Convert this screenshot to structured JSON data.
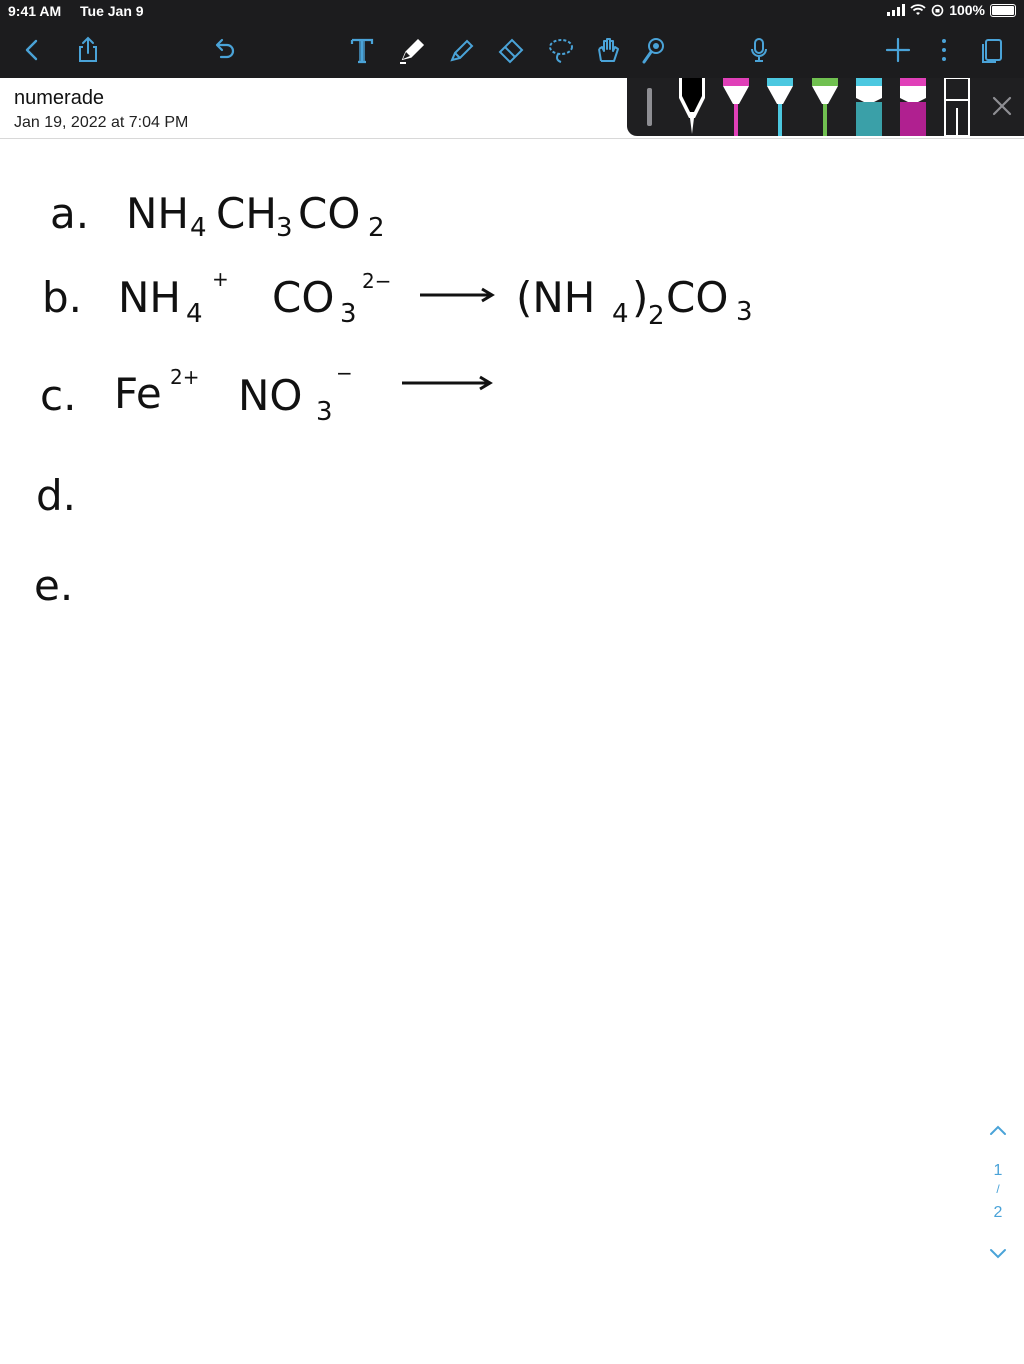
{
  "status_bar": {
    "time": "9:41 AM",
    "date": "Tue Jan 9",
    "battery": "100%"
  },
  "toolbar": {
    "icons": [
      "back-icon",
      "share-icon",
      "undo-icon",
      "text-tool-icon",
      "pen-tool-icon",
      "highlighter-tool-icon",
      "eraser-tool-icon",
      "lasso-tool-icon",
      "hand-tool-icon",
      "shapes-tool-icon",
      "microphone-icon",
      "add-icon",
      "more-icon",
      "pages-icon"
    ],
    "icon_color": "#4aa3d8"
  },
  "document": {
    "title": "numerade",
    "date": "Jan 19, 2022 at 7:04 PM"
  },
  "pen_tray": {
    "tools": [
      {
        "name": "black-pen",
        "color": "#000000"
      },
      {
        "name": "magenta-pen",
        "color": "#e040b8"
      },
      {
        "name": "cyan-pen",
        "color": "#4cc8e0"
      },
      {
        "name": "green-pen",
        "color": "#70c050"
      },
      {
        "name": "teal-highlighter",
        "color": "#3aa0a8"
      },
      {
        "name": "purple-highlighter",
        "color": "#b02090"
      },
      {
        "name": "eraser",
        "color": "#ffffff"
      }
    ]
  },
  "notes": {
    "a_label": "a.",
    "a_main": "NH",
    "a_sub1": "4",
    "a_mid": "CH",
    "a_sub2": "3",
    "a_end": "CO",
    "a_sub3": "2",
    "b_label": "b.",
    "b_ion1": "NH",
    "b_ion1_sub": "4",
    "b_ion1_sup": "+",
    "b_ion2": "CO",
    "b_ion2_sub": "3",
    "b_ion2_sup": "2−",
    "b_prod1": "(NH",
    "b_prod_sub1": "4",
    "b_prod2": ")",
    "b_prod_sub2": "2",
    "b_prod3": "CO",
    "b_prod_sub3": "3",
    "c_label": "c.",
    "c_ion1": "Fe",
    "c_ion1_sup": "2+",
    "c_ion2": "NO",
    "c_ion2_sub": "3",
    "c_ion2_sup": "−",
    "d_label": "d.",
    "e_label": "e."
  },
  "page_nav": {
    "current": "1",
    "separator": "/",
    "total": "2"
  }
}
